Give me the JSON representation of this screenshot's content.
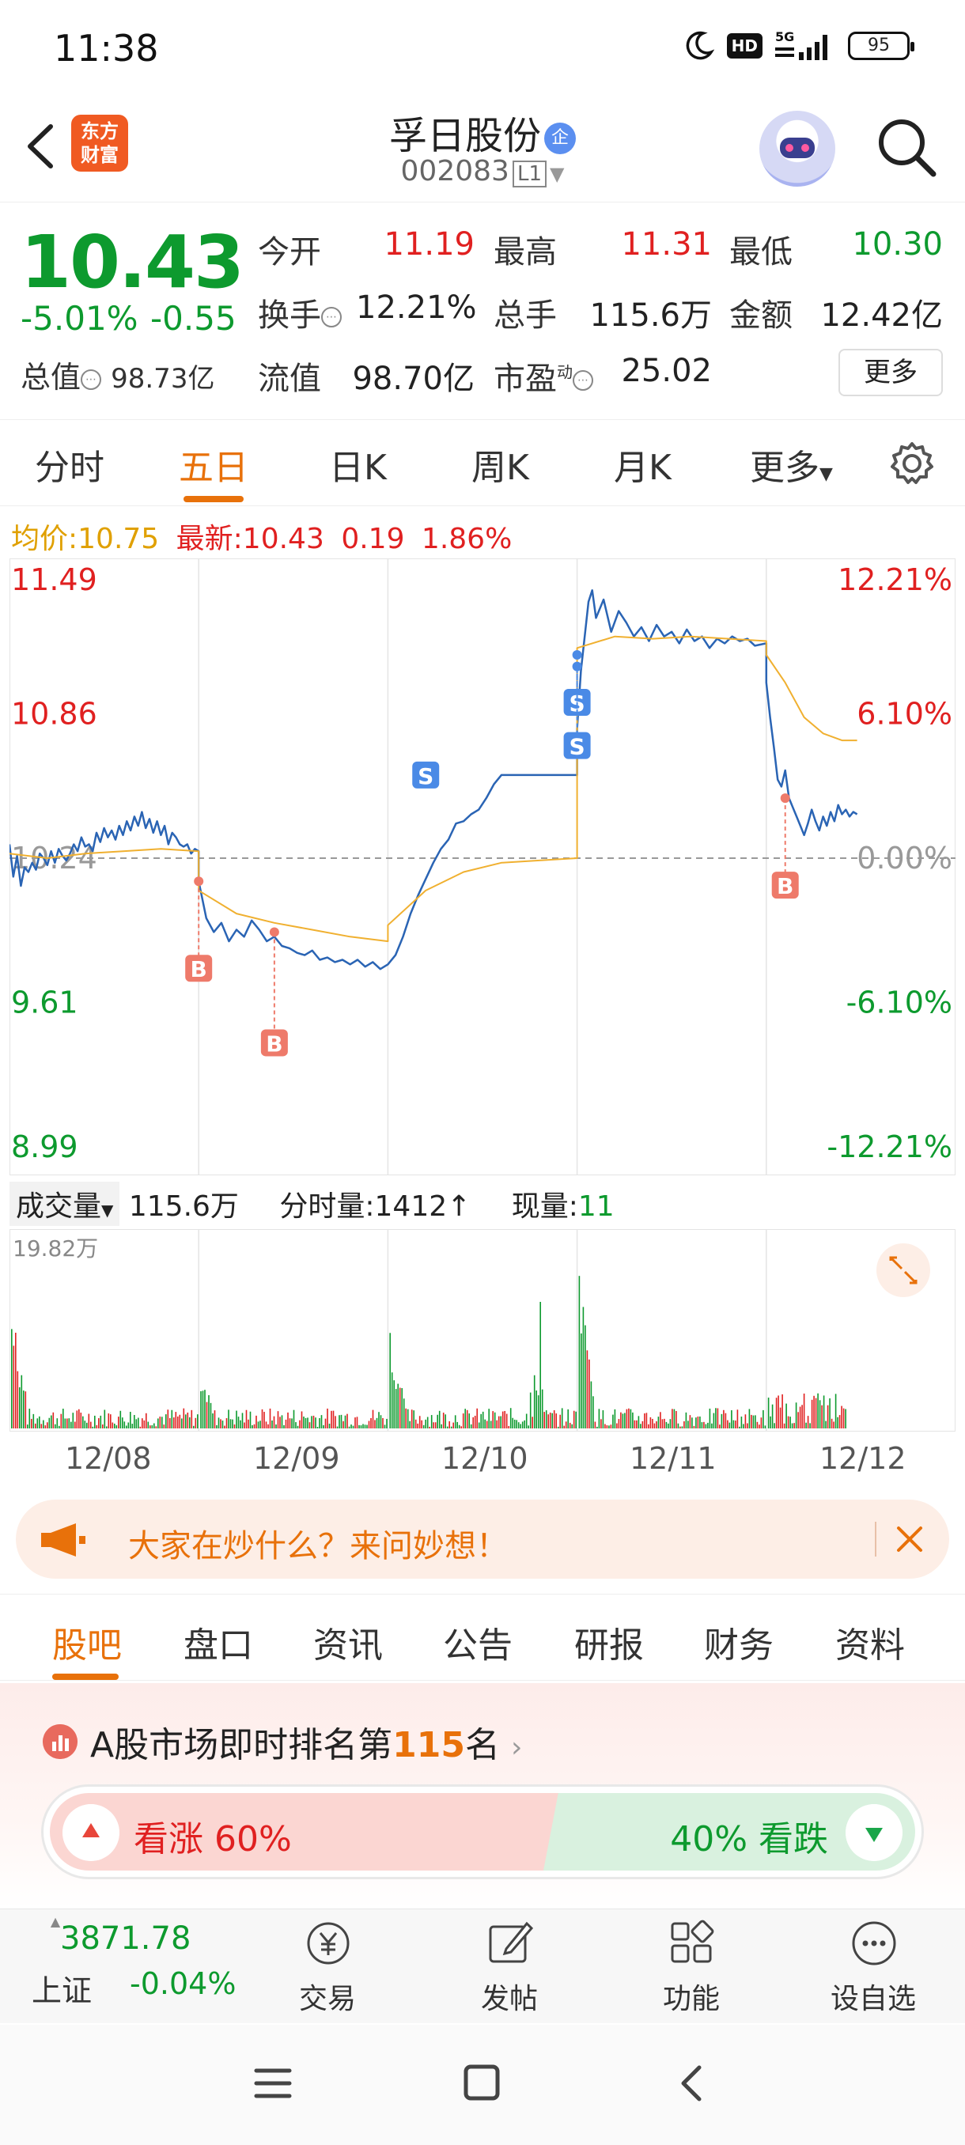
{
  "status": {
    "time": "11:38",
    "hd": "HD",
    "network": "5G",
    "battery": "95"
  },
  "header": {
    "logo_line1": "东方",
    "logo_line2": "财富",
    "stock_name": "孚日股份",
    "badge": "企",
    "stock_code": "002083",
    "level": "L1"
  },
  "quote": {
    "price": "10.43",
    "pct": "-5.01%",
    "change": "-0.55",
    "rows": [
      [
        {
          "label": "今开",
          "value": "11.19",
          "color": "red"
        },
        {
          "label": "最高",
          "value": "11.31",
          "color": "red"
        },
        {
          "label": "最低",
          "value": "10.30",
          "color": "green"
        }
      ],
      [
        {
          "label": "换手",
          "value": "12.21%",
          "color": "black"
        },
        {
          "label": "总手",
          "value": "115.6万",
          "color": "black"
        },
        {
          "label": "金额",
          "value": "12.42亿",
          "color": "black"
        }
      ]
    ],
    "row3": {
      "zongzhi_label": "总值",
      "zongzhi": "98.73亿",
      "liuzhi_label": "流值",
      "liuzhi": "98.70亿",
      "shiying_label": "市盈",
      "shiying_sup": "动",
      "shiying": "25.02"
    },
    "more": "更多"
  },
  "period_tabs": [
    "分时",
    "五日",
    "日K",
    "周K",
    "月K",
    "更多"
  ],
  "chart_info": {
    "avg_label": "均价:",
    "avg": "10.75",
    "latest_label": "最新:",
    "latest": "10.43",
    "latest_change": "0.19",
    "latest_pct": "1.86%"
  },
  "chart_data": {
    "type": "line",
    "title": "",
    "days": [
      "12/08",
      "12/09",
      "12/10",
      "12/11",
      "12/12"
    ],
    "left_axis": [
      "11.49",
      "10.86",
      "10.24",
      "9.61",
      "8.99"
    ],
    "right_axis": [
      "12.21%",
      "6.10%",
      "0.00%",
      "-6.10%",
      "-12.21%"
    ],
    "ylim": [
      8.99,
      11.49
    ],
    "prev_close": 10.24,
    "series": [
      {
        "color": "#2a64b4",
        "x": [
          0,
          0.02,
          0.04,
          0.06,
          0.08,
          0.1,
          0.12,
          0.14,
          0.16,
          0.18,
          0.2,
          0.22,
          0.24,
          0.26,
          0.28,
          0.3,
          0.32,
          0.34,
          0.36,
          0.38,
          0.4,
          0.42,
          0.44,
          0.46,
          0.48,
          0.5,
          0.52,
          0.54,
          0.56,
          0.58,
          0.6,
          0.62,
          0.64,
          0.66,
          0.68,
          0.7,
          0.72,
          0.74,
          0.76,
          0.78,
          0.8,
          0.82,
          0.84,
          0.86,
          0.88,
          0.9,
          0.92,
          0.94,
          0.96,
          0.98,
          1.0,
          1.0,
          1.04,
          1.08,
          1.12,
          1.16,
          1.2,
          1.24,
          1.28,
          1.32,
          1.36,
          1.4,
          1.44,
          1.48,
          1.52,
          1.56,
          1.6,
          1.64,
          1.68,
          1.72,
          1.76,
          1.8,
          1.84,
          1.88,
          1.92,
          1.96,
          2.0,
          2.0,
          2.04,
          2.08,
          2.12,
          2.16,
          2.2,
          2.24,
          2.28,
          2.32,
          2.36,
          2.4,
          2.44,
          2.48,
          2.52,
          2.56,
          2.6,
          2.64,
          2.68,
          2.72,
          2.76,
          2.8,
          2.84,
          2.88,
          2.92,
          2.96,
          3.0,
          3.0,
          3.02,
          3.04,
          3.06,
          3.08,
          3.1,
          3.14,
          3.18,
          3.22,
          3.26,
          3.3,
          3.34,
          3.38,
          3.42,
          3.46,
          3.5,
          3.54,
          3.58,
          3.62,
          3.66,
          3.7,
          3.74,
          3.78,
          3.82,
          3.86,
          3.9,
          3.94,
          4.0,
          4.0,
          4.02,
          4.04,
          4.06,
          4.08,
          4.1,
          4.12,
          4.14,
          4.16,
          4.18,
          4.2,
          4.22,
          4.24,
          4.26,
          4.28,
          4.3,
          4.32,
          4.34,
          4.36,
          4.38,
          4.4,
          4.42,
          4.44,
          4.46,
          4.48
        ],
        "values": [
          10.3,
          10.16,
          10.25,
          10.12,
          10.2,
          10.18,
          10.22,
          10.19,
          10.26,
          10.24,
          10.21,
          10.27,
          10.22,
          10.28,
          10.25,
          10.23,
          10.26,
          10.3,
          10.27,
          10.33,
          10.29,
          10.3,
          10.27,
          10.35,
          10.31,
          10.37,
          10.33,
          10.36,
          10.32,
          10.38,
          10.34,
          10.4,
          10.36,
          10.42,
          10.38,
          10.44,
          10.37,
          10.41,
          10.35,
          10.4,
          10.34,
          10.38,
          10.3,
          10.35,
          10.33,
          10.3,
          10.29,
          10.3,
          10.26,
          10.28,
          10.27,
          10.14,
          9.98,
          9.92,
          9.96,
          9.88,
          9.93,
          9.9,
          9.97,
          9.93,
          9.88,
          9.9,
          9.86,
          9.85,
          9.83,
          9.82,
          9.84,
          9.8,
          9.81,
          9.79,
          9.8,
          9.78,
          9.8,
          9.77,
          9.79,
          9.76,
          9.78,
          9.78,
          9.82,
          9.9,
          10.0,
          10.08,
          10.15,
          10.22,
          10.28,
          10.32,
          10.39,
          10.4,
          10.43,
          10.45,
          10.5,
          10.56,
          10.6,
          10.6,
          10.6,
          10.6,
          10.6,
          10.6,
          10.6,
          10.6,
          10.6,
          10.6,
          10.6,
          10.8,
          11.05,
          11.2,
          11.35,
          11.4,
          11.28,
          11.36,
          11.22,
          11.31,
          11.26,
          11.2,
          11.24,
          11.18,
          11.25,
          11.2,
          11.22,
          11.17,
          11.23,
          11.18,
          11.2,
          11.15,
          11.19,
          11.17,
          11.2,
          11.18,
          11.19,
          11.16,
          11.17,
          11.0,
          10.85,
          10.72,
          10.58,
          10.55,
          10.62,
          10.5,
          10.46,
          10.42,
          10.38,
          10.34,
          10.39,
          10.45,
          10.4,
          10.36,
          10.42,
          10.38,
          10.44,
          10.4,
          10.47,
          10.43,
          10.45,
          10.42,
          10.44,
          10.43
        ]
      },
      {
        "color": "#f0b030",
        "x": [
          0,
          0.2,
          0.4,
          0.6,
          0.8,
          1.0,
          1.0,
          1.2,
          1.4,
          1.6,
          1.8,
          2.0,
          2.0,
          2.2,
          2.4,
          2.6,
          2.8,
          3.0,
          3.0,
          3.2,
          3.4,
          3.6,
          3.8,
          4.0,
          4.0,
          4.1,
          4.2,
          4.3,
          4.4,
          4.48
        ],
        "values": [
          10.26,
          10.24,
          10.26,
          10.27,
          10.28,
          10.27,
          10.1,
          10.0,
          9.96,
          9.93,
          9.9,
          9.88,
          9.95,
          10.1,
          10.18,
          10.22,
          10.23,
          10.24,
          11.15,
          11.2,
          11.19,
          11.2,
          11.19,
          11.18,
          11.12,
          11.0,
          10.85,
          10.78,
          10.75,
          10.75
        ]
      }
    ],
    "markers": [
      {
        "label": "S",
        "x": 2.2,
        "value": 10.6,
        "type": "sell"
      },
      {
        "label": "S",
        "x": 3.0,
        "value": 11.12,
        "type": "sell"
      },
      {
        "label": "S",
        "x": 3.0,
        "value": 11.07,
        "type": "sell"
      },
      {
        "label": "B",
        "x": 1.0,
        "value": 10.14,
        "type": "buy"
      },
      {
        "label": "B",
        "x": 1.4,
        "value": 9.92,
        "type": "buy"
      },
      {
        "label": "B",
        "x": 4.1,
        "value": 10.5,
        "type": "buy"
      }
    ],
    "volume": {
      "label": "成交量",
      "total": "115.6万",
      "fenshi_label": "分时量:",
      "fenshi": "1412",
      "xianliang_label": "现量:",
      "xianliang": "11",
      "max_label": "19.82万",
      "max": 19.82
    }
  },
  "banner": {
    "text": "大家在炒什么？来问妙想！"
  },
  "content_tabs": [
    "股吧",
    "盘口",
    "资讯",
    "公告",
    "研报",
    "财务",
    "资料"
  ],
  "rank": {
    "prefix": "A股市场即时排名第",
    "number": "115",
    "suffix": "名"
  },
  "sentiment": {
    "bull": "看涨 60%",
    "bear": "40% 看跌",
    "bull_pct": 60
  },
  "toolbar": {
    "index_value": "3871.78",
    "index_name": "上证",
    "index_change": "-0.04%",
    "items": [
      "交易",
      "发帖",
      "功能",
      "设自选"
    ]
  }
}
